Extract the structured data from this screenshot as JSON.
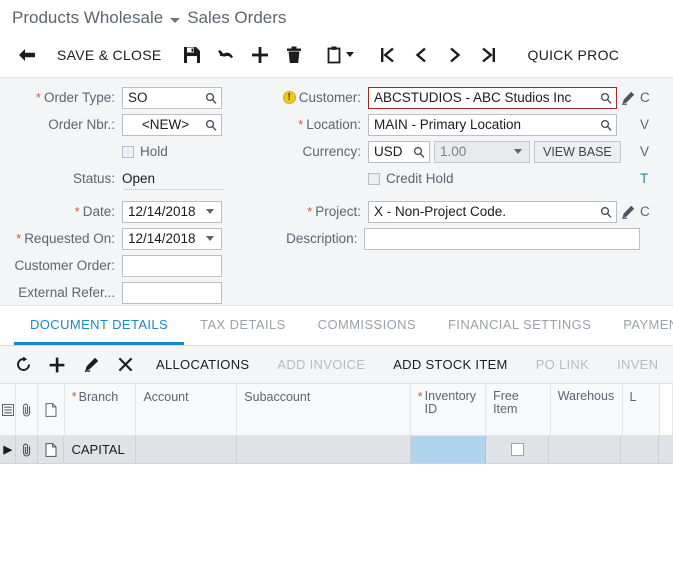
{
  "header": {
    "company": "Products Wholesale",
    "screen": "Sales Orders"
  },
  "toolbar": {
    "back_icon": "back-arrow-icon",
    "save_close": "SAVE & CLOSE",
    "save_icon": "save-disk-icon",
    "undo_icon": "undo-icon",
    "add_icon": "plus-icon",
    "delete_icon": "trash-icon",
    "clipboard_icon": "clipboard-icon",
    "first_icon": "first-record-icon",
    "prev_icon": "previous-record-icon",
    "next_icon": "next-record-icon",
    "last_icon": "last-record-icon",
    "quick_process": "QUICK PROC"
  },
  "form": {
    "left": {
      "order_type_label": "Order Type:",
      "order_type_value": "SO",
      "order_nbr_label": "Order Nbr.:",
      "order_nbr_value": "<NEW>",
      "hold_label": "Hold",
      "status_label": "Status:",
      "status_value": "Open",
      "date_label": "Date:",
      "date_value": "12/14/2018",
      "requested_on_label": "Requested On:",
      "requested_on_value": "12/14/2018",
      "customer_order_label": "Customer Order:",
      "customer_order_value": "",
      "external_ref_label": "External Refer...",
      "external_ref_value": ""
    },
    "right": {
      "customer_label": "Customer:",
      "customer_value": "ABCSTUDIOS - ABC Studios Inc",
      "location_label": "Location:",
      "location_value": "MAIN - Primary Location",
      "currency_label": "Currency:",
      "currency_value": "USD",
      "rate_value": "1.00",
      "view_base_label": "VIEW BASE",
      "credit_hold_label": "Credit Hold",
      "project_label": "Project:",
      "project_value": "X - Non-Project Code.",
      "description_label": "Description:",
      "description_value": ""
    },
    "clipped": {
      "r1": "C",
      "r2": "V",
      "r3": "V",
      "r4": "T",
      "r5": "C"
    },
    "colors": {
      "error_border": "#9b2b22",
      "required_star": "#d95b43",
      "warning_icon": "#f5c518",
      "panel_bg": "#f4f5f7"
    }
  },
  "tabs": [
    {
      "label": "DOCUMENT DETAILS",
      "active": true
    },
    {
      "label": "TAX DETAILS",
      "active": false
    },
    {
      "label": "COMMISSIONS",
      "active": false
    },
    {
      "label": "FINANCIAL SETTINGS",
      "active": false
    },
    {
      "label": "PAYMENT S",
      "active": false
    }
  ],
  "grid_toolbar": {
    "refresh_icon": "refresh-icon",
    "add_icon": "plus-icon",
    "edit_icon": "pencil-icon",
    "delete_icon": "close-x-icon",
    "allocations": "ALLOCATIONS",
    "add_invoice": "ADD INVOICE",
    "add_stock_item": "ADD STOCK ITEM",
    "po_link": "PO LINK",
    "inventory": "INVEN"
  },
  "grid": {
    "columns": [
      {
        "label": "",
        "icon": "grid-settings-icon",
        "required": false
      },
      {
        "label": "",
        "icon": "paperclip-icon",
        "required": false
      },
      {
        "label": "",
        "icon": "note-icon",
        "required": false
      },
      {
        "label": "Branch",
        "required": true
      },
      {
        "label": "Account",
        "required": false
      },
      {
        "label": "Subaccount",
        "required": false
      },
      {
        "label": "Inventory ID",
        "required": true
      },
      {
        "label": "Free Item",
        "required": false
      },
      {
        "label": "Warehous",
        "required": false
      },
      {
        "label": "L",
        "required": false
      }
    ],
    "rows": [
      {
        "selector": "▶",
        "attachment_icon": "paperclip-icon",
        "note_icon": "note-icon",
        "branch": "CAPITAL",
        "account": "",
        "subaccount": "",
        "inventory_id": "",
        "inventory_selected": true,
        "free_item": false,
        "warehouse": "",
        "l": ""
      }
    ]
  }
}
